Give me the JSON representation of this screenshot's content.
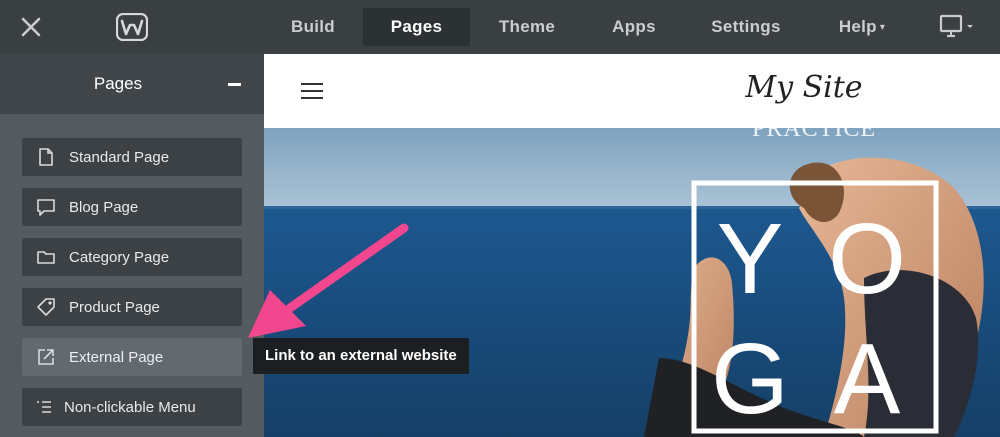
{
  "topbar": {
    "close_icon": "close-icon",
    "logo_icon": "weebly-logo",
    "nav": [
      {
        "label": "Build"
      },
      {
        "label": "Pages",
        "active": true
      },
      {
        "label": "Theme"
      },
      {
        "label": "Apps"
      },
      {
        "label": "Settings"
      },
      {
        "label": "Help",
        "caret": "▾"
      }
    ],
    "device_icon": "desktop-monitor-icon"
  },
  "sidebar": {
    "title": "Pages",
    "collapse_icon": "minus-icon",
    "items": [
      {
        "label": "Standard Page",
        "icon": "document-icon"
      },
      {
        "label": "Blog Page",
        "icon": "speech-bubble-icon"
      },
      {
        "label": "Category Page",
        "icon": "folder-icon"
      },
      {
        "label": "Product Page",
        "icon": "tag-icon"
      },
      {
        "label": "External Page",
        "icon": "external-link-icon"
      },
      {
        "label": "Non-clickable Menu",
        "icon": "menu-list-icon"
      }
    ]
  },
  "canvas": {
    "site_title": "My Site",
    "hero_subtitle": "PRACTICE",
    "hero_letters": [
      "Y",
      "O",
      "G",
      "A"
    ]
  },
  "tooltip": {
    "text": "Link to an external website"
  },
  "colors": {
    "topbar_bg": "#3a3f42",
    "sidebar_bg": "#545b60",
    "button_bg": "#3b4145",
    "arrow": "#f2478f",
    "sea": "#204f7c"
  }
}
